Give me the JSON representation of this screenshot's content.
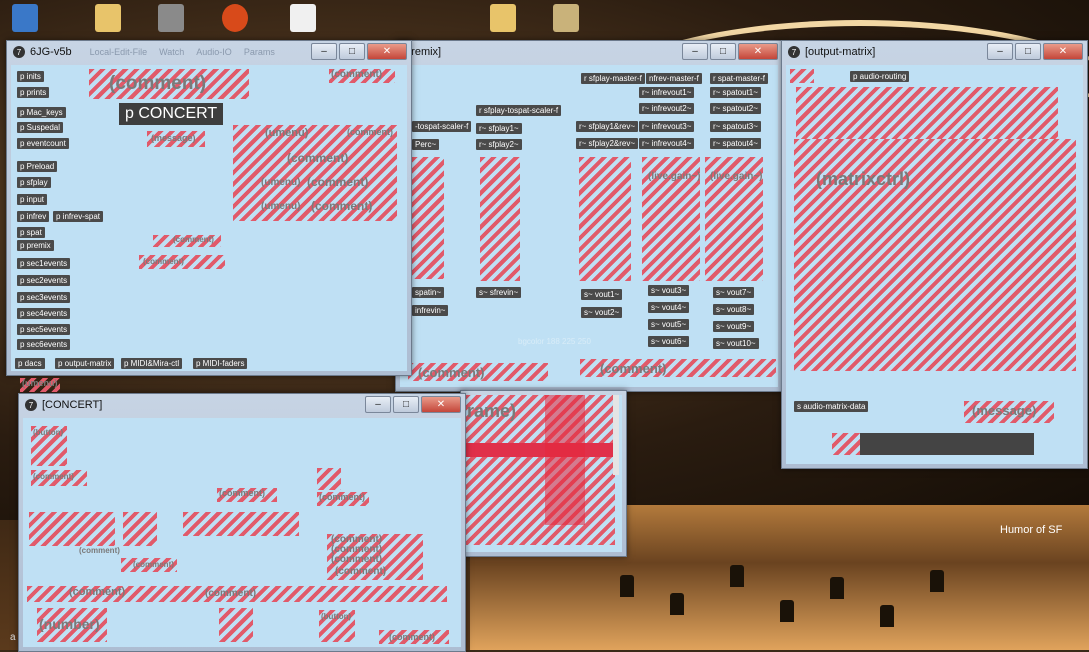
{
  "desktop": {
    "humor_label": "Humor of SF",
    "letter_a": "a"
  },
  "win_6jg": {
    "title": "6JG-v5b",
    "faint_menu": [
      "Local-Edit-File",
      "Watch",
      "Audio-IO",
      "Params"
    ],
    "objects": [
      "p inits",
      "p prints",
      "p Mac_keys",
      "p Suspedal",
      "p eventcount",
      "p Preload",
      "p sfplay",
      "p input",
      "p infrev",
      "p infrev-spat",
      "p spat",
      "p premix",
      "p sec1events",
      "p sec2events",
      "p sec3events",
      "p sec4events",
      "p sec5events",
      "p sec6events",
      "p dacs",
      "p output-matrix",
      "p MIDI&Mira-ctl",
      "p MIDI-faders"
    ],
    "concert": "p CONCERT",
    "comment_big": "(comment)",
    "comment_small": "(comment)",
    "message": "(message)",
    "umenu": "(umenu)",
    "comment": "(comment)"
  },
  "win_premix": {
    "title": "[premix]",
    "objects": {
      "sfplay_master": "r sfplay-master-f",
      "infrev_master": "nfrev-master-f",
      "spat_master": "r spat-master-f",
      "sfplay_tospat": "r sfplay-tospat-scaler-f",
      "tospat_scaler": "-tospat-scaler-f",
      "perc": "Perc~",
      "r_sfplay1": "r~ sfplay1~",
      "r_sfplay2": "r~ sfplay2~",
      "r_infrevout1": "r~ infrevout1~",
      "r_infrevout2": "r~ infrevout2~",
      "r_infrevout3": "r~ infrevout3~",
      "r_infrevout4": "r~ infrevout4~",
      "r_sfplay1rev": "r~ sfplay1&rev~",
      "r_sfplay2rev": "r~ sfplay2&rev~",
      "r_spatout1": "r~ spatout1~",
      "r_spatout2": "r~ spatout2~",
      "r_spatout3": "r~ spatout3~",
      "r_spatout4": "r~ spatout4~",
      "spatin": "spatin~",
      "infrevin": "infrevin~",
      "sfrevin": "s~ sfrevin~",
      "vout1": "s~ vout1~",
      "vout2": "s~ vout2~",
      "vout3": "s~ vout3~",
      "vout4": "s~ vout4~",
      "vout5": "s~ vout5~",
      "vout6": "s~ vout6~",
      "vout7": "s~ vout7~",
      "vout8": "s~ vout8~",
      "vout9": "s~ vout9~",
      "vout10": "s~ vout10~"
    },
    "live_gain": "(live.gain~)",
    "bgcolor_note": "bgcolor 188 225 250",
    "comment": "(comment)",
    "frame": "rame)"
  },
  "win_output": {
    "title": "[output-matrix]",
    "audio_routing": "p audio-routing",
    "matrixctrl": "(matrixctrl)",
    "audio_matrix_data": "s audio-matrix-data",
    "message": "(message)"
  },
  "win_concert": {
    "title": "[CONCERT]",
    "button": "(button)",
    "comment": "(comment)",
    "number": "(number)",
    "behind_label": "(umenu)"
  },
  "colors": {
    "canvas": "#bfe0f4",
    "hatch": "#e15a6a",
    "object": "#4a4a4a"
  }
}
